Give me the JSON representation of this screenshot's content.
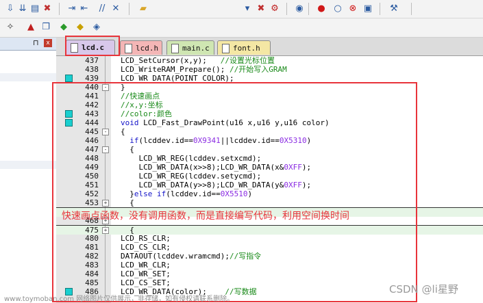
{
  "toolbar_top": {
    "icons": [
      "download-icon",
      "download-all-icon",
      "translate-icon",
      "stop-build-icon",
      "indent-icon",
      "unindent-icon",
      "comment-icon",
      "uncomment-icon",
      "open-folder-icon",
      "dropdown-icon",
      "close-file-icon",
      "debug-icon",
      "start-debug-icon",
      "breakpoint-icon",
      "disabled-breakpoint-icon",
      "kill-breakpoints-icon",
      "window-icon",
      "tools-icon"
    ]
  },
  "toolbar_second": {
    "icons": [
      "magic-wand-icon",
      "target-options-icon",
      "copy-icon",
      "green-diamond-icon",
      "yellow-diamond-icon",
      "stack-icon"
    ]
  },
  "left_pane": {
    "pin": "⊓",
    "close": "x"
  },
  "tabs": [
    {
      "label": "lcd.c",
      "active": true
    },
    {
      "label": "lcd.h",
      "active": false
    },
    {
      "label": "main.c",
      "active": false
    },
    {
      "label": "font.h",
      "active": false
    }
  ],
  "code_lines": [
    {
      "ln": "437",
      "bm": false,
      "fold": "",
      "parts": [
        {
          "t": "LCD_SetCursor(x,y);   ",
          "c": ""
        },
        {
          "t": "//设置光标位置",
          "c": "cmt"
        }
      ]
    },
    {
      "ln": "438",
      "bm": false,
      "fold": "",
      "parts": [
        {
          "t": "LCD_WriteRAM_Prepare(); ",
          "c": ""
        },
        {
          "t": "//开始写入GRAM",
          "c": "cmt"
        }
      ]
    },
    {
      "ln": "439",
      "bm": true,
      "fold": "",
      "parts": [
        {
          "t": "LCD_WR_DATA(POINT_COLOR);",
          "c": ""
        }
      ]
    },
    {
      "ln": "440",
      "bm": false,
      "fold": "-",
      "parts": [
        {
          "t": "}",
          "c": ""
        }
      ]
    },
    {
      "ln": "441",
      "bm": false,
      "fold": "",
      "parts": [
        {
          "t": "//快速画点",
          "c": "cmt"
        }
      ]
    },
    {
      "ln": "442",
      "bm": false,
      "fold": "",
      "parts": [
        {
          "t": "//x,y:坐标",
          "c": "cmt"
        }
      ]
    },
    {
      "ln": "443",
      "bm": true,
      "fold": "",
      "parts": [
        {
          "t": "//color:颜色",
          "c": "cmt"
        }
      ]
    },
    {
      "ln": "444",
      "bm": true,
      "fold": "",
      "parts": [
        {
          "t": "void ",
          "c": "kw"
        },
        {
          "t": "LCD_Fast_DrawPoint(u16 x,u16 y,u16 color)",
          "c": ""
        }
      ]
    },
    {
      "ln": "445",
      "bm": false,
      "fold": "-",
      "parts": [
        {
          "t": "{",
          "c": ""
        }
      ]
    },
    {
      "ln": "446",
      "bm": false,
      "fold": "",
      "parts": [
        {
          "t": "  ",
          "c": ""
        },
        {
          "t": "if",
          "c": "kw"
        },
        {
          "t": "(lcddev.id==",
          "c": ""
        },
        {
          "t": "0X9341",
          "c": "num"
        },
        {
          "t": "||lcddev.id==",
          "c": ""
        },
        {
          "t": "0X5310",
          "c": "num"
        },
        {
          "t": ")",
          "c": ""
        }
      ]
    },
    {
      "ln": "447",
      "bm": false,
      "fold": "-",
      "parts": [
        {
          "t": "  {",
          "c": ""
        }
      ]
    },
    {
      "ln": "448",
      "bm": false,
      "fold": "",
      "parts": [
        {
          "t": "    LCD_WR_REG(lcddev.setxcmd);",
          "c": ""
        }
      ]
    },
    {
      "ln": "449",
      "bm": false,
      "fold": "",
      "parts": [
        {
          "t": "    LCD_WR_DATA(x>>8);LCD_WR_DATA(x&",
          "c": ""
        },
        {
          "t": "0XFF",
          "c": "num"
        },
        {
          "t": ");",
          "c": ""
        }
      ]
    },
    {
      "ln": "450",
      "bm": false,
      "fold": "",
      "parts": [
        {
          "t": "    LCD_WR_REG(lcddev.setycmd);",
          "c": ""
        }
      ]
    },
    {
      "ln": "451",
      "bm": false,
      "fold": "",
      "parts": [
        {
          "t": "    LCD_WR_DATA(y>>8);LCD_WR_DATA(y&",
          "c": ""
        },
        {
          "t": "0XFF",
          "c": "num"
        },
        {
          "t": ");",
          "c": ""
        }
      ]
    },
    {
      "ln": "452",
      "bm": false,
      "fold": "",
      "parts": [
        {
          "t": "  }",
          "c": ""
        },
        {
          "t": "else if",
          "c": "kw"
        },
        {
          "t": "(lcddev.id==",
          "c": ""
        },
        {
          "t": "0X5510",
          "c": "num"
        },
        {
          "t": ")",
          "c": ""
        }
      ]
    },
    {
      "ln": "453",
      "bm": false,
      "fold": "+",
      "parts": [
        {
          "t": "  {",
          "c": ""
        }
      ]
    },
    {
      "ln": "",
      "bm": false,
      "fold": "",
      "collapsed": true,
      "parts": []
    },
    {
      "ln": "468",
      "bm": false,
      "fold": "+",
      "parts": [
        {
          "t": "  ",
          "c": ""
        }
      ]
    },
    {
      "ln": "475",
      "bm": false,
      "fold": "+",
      "collapsed": true,
      "parts": [
        {
          "t": "  {",
          "c": ""
        }
      ]
    },
    {
      "ln": "480",
      "bm": false,
      "fold": "",
      "parts": [
        {
          "t": "LCD_RS_CLR;",
          "c": ""
        }
      ]
    },
    {
      "ln": "481",
      "bm": false,
      "fold": "",
      "parts": [
        {
          "t": "LCD_CS_CLR;",
          "c": ""
        }
      ]
    },
    {
      "ln": "482",
      "bm": false,
      "fold": "",
      "parts": [
        {
          "t": "DATAOUT(lcddev.wramcmd);",
          "c": ""
        },
        {
          "t": "//写指令",
          "c": "cmt"
        }
      ]
    },
    {
      "ln": "483",
      "bm": false,
      "fold": "",
      "parts": [
        {
          "t": "LCD_WR_CLR;",
          "c": ""
        }
      ]
    },
    {
      "ln": "484",
      "bm": false,
      "fold": "",
      "parts": [
        {
          "t": "LCD_WR_SET;",
          "c": ""
        }
      ]
    },
    {
      "ln": "485",
      "bm": false,
      "fold": "",
      "parts": [
        {
          "t": "LCD_CS_SET;",
          "c": ""
        }
      ]
    },
    {
      "ln": "486",
      "bm": true,
      "fold": "",
      "parts": [
        {
          "t": "LCD_WR_DATA(color);    ",
          "c": ""
        },
        {
          "t": "//写数据",
          "c": "cmt"
        }
      ]
    }
  ],
  "annotation": "快速画点函数，没有调用函数，而是直接编写代码，利用空间换时间",
  "watermark": "www.toymoban.com 网络图片仅供展示，非存储，如有侵权请联系删除。",
  "credit": "CSDN @li星野",
  "colors": {
    "highlight": "#e8333a",
    "bookmark": "#19cfcf"
  }
}
